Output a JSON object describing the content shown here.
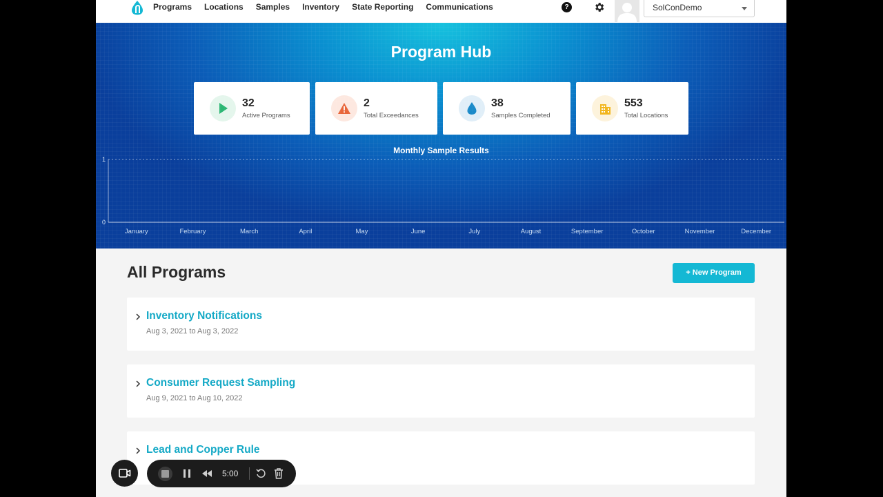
{
  "nav": {
    "links": [
      "Programs",
      "Locations",
      "Samples",
      "Inventory",
      "State Reporting",
      "Communications"
    ],
    "help_glyph": "?",
    "account": "SolConDemo"
  },
  "hero": {
    "title": "Program Hub",
    "stats": [
      {
        "value": "32",
        "label": "Active Programs",
        "icon": "play-icon",
        "color": "#2bb673"
      },
      {
        "value": "2",
        "label": "Total Exceedances",
        "icon": "warning-icon",
        "color": "#e8663a"
      },
      {
        "value": "38",
        "label": "Samples Completed",
        "icon": "water-drop-icon",
        "color": "#1a8ac9"
      },
      {
        "value": "553",
        "label": "Total Locations",
        "icon": "building-icon",
        "color": "#f2b51c"
      }
    ]
  },
  "chart_data": {
    "type": "line",
    "title": "Monthly Sample Results",
    "categories": [
      "January",
      "February",
      "March",
      "April",
      "May",
      "June",
      "July",
      "August",
      "September",
      "October",
      "November",
      "December"
    ],
    "yticks": [
      "0",
      "1"
    ],
    "ylim": [
      0,
      1
    ],
    "series": [],
    "grid": true
  },
  "programs": {
    "title": "All Programs",
    "new_button": "+ New Program",
    "items": [
      {
        "name": "Inventory Notifications",
        "dates": "Aug 3, 2021 to Aug 3, 2022"
      },
      {
        "name": "Consumer Request Sampling",
        "dates": "Aug 9, 2021 to Aug 10, 2022"
      },
      {
        "name": "Lead and Copper Rule",
        "dates": ""
      }
    ]
  },
  "recorder": {
    "time": "5:00"
  }
}
